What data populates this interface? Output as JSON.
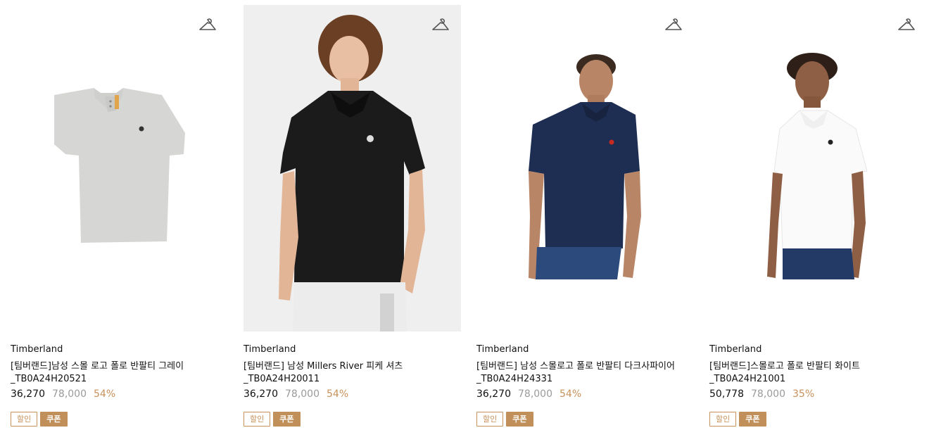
{
  "icons": {
    "wishlist": "hanger-icon"
  },
  "colors": {
    "accent": "#c6915a",
    "coupon_bg": "#c08f5a",
    "muted_price": "#9a9a9a",
    "studio_bg": "#efefef"
  },
  "products": [
    {
      "brand": "Timberland",
      "title": "[팀버랜드]남성 스몰 로고 폴로 반팔티 그레이\n_TB0A24H20521",
      "price": "36,270",
      "original_price": "78,000",
      "discount": "54%",
      "badges": [
        "할인",
        "쿠폰"
      ]
    },
    {
      "brand": "Timberland",
      "title": "[팀버랜드] 남성 Millers River 피케 셔츠\n_TB0A24H20011",
      "price": "36,270",
      "original_price": "78,000",
      "discount": "54%",
      "badges": [
        "할인",
        "쿠폰"
      ]
    },
    {
      "brand": "Timberland",
      "title": "[팀버랜드] 남성 스몰로고 폴로 반팔티 다크사파이어\n_TB0A24H24331",
      "price": "36,270",
      "original_price": "78,000",
      "discount": "54%",
      "badges": [
        "할인",
        "쿠폰"
      ]
    },
    {
      "brand": "Timberland",
      "title": "[팀버랜드]스몰로고 폴로 반팔티 화이트\n_TB0A24H21001",
      "price": "50,778",
      "original_price": "78,000",
      "discount": "35%",
      "badges": [
        "할인",
        "쿠폰"
      ]
    }
  ]
}
